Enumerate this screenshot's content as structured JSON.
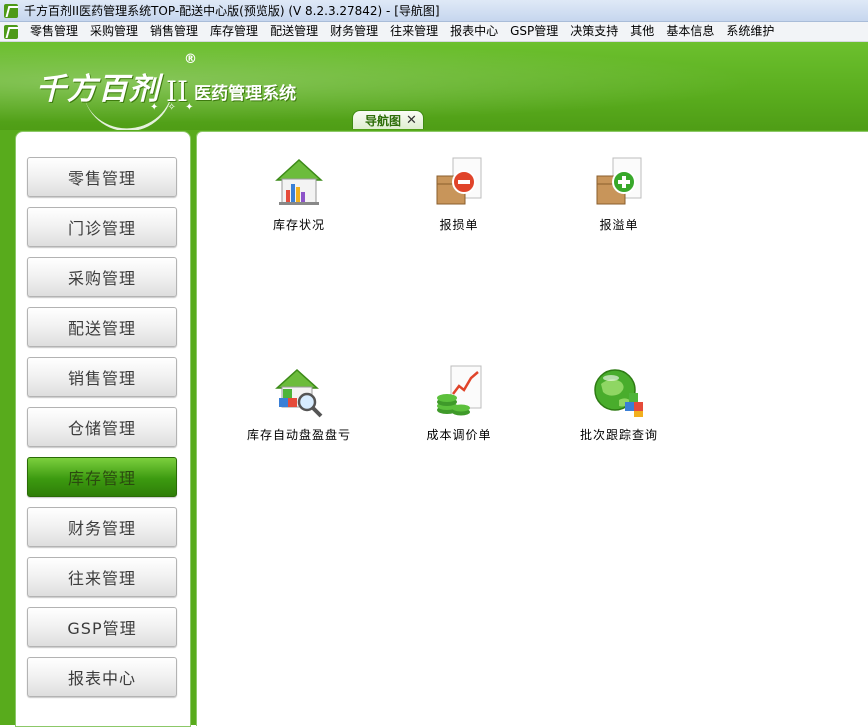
{
  "window": {
    "title": "千方百剂II医药管理系统TOP-配送中心版(预览版) (V 8.2.3.27842)   - [导航图]"
  },
  "menu": [
    "零售管理",
    "采购管理",
    "销售管理",
    "库存管理",
    "配送管理",
    "财务管理",
    "往来管理",
    "报表中心",
    "GSP管理",
    "决策支持",
    "其他",
    "基本信息",
    "系统维护"
  ],
  "brand": {
    "name": "千方百剂",
    "roman": "II",
    "subtitle": "医药管理系统",
    "reg": "®"
  },
  "tab": {
    "label": "导航图",
    "close": "✕"
  },
  "sidebar": {
    "items": [
      {
        "label": "零售管理"
      },
      {
        "label": "门诊管理"
      },
      {
        "label": "采购管理"
      },
      {
        "label": "配送管理"
      },
      {
        "label": "销售管理"
      },
      {
        "label": "仓储管理"
      },
      {
        "label": "库存管理",
        "active": true
      },
      {
        "label": "财务管理"
      },
      {
        "label": "往来管理"
      },
      {
        "label": "GSP管理"
      },
      {
        "label": "报表中心"
      }
    ]
  },
  "tiles": [
    {
      "label": "库存状况",
      "icon": "house-chart-icon"
    },
    {
      "label": "报损单",
      "icon": "box-minus-icon"
    },
    {
      "label": "报溢单",
      "icon": "box-plus-icon"
    },
    {
      "label": "库存自动盘盈盘亏",
      "icon": "house-magnifier-icon"
    },
    {
      "label": "成本调价单",
      "icon": "coins-chart-icon"
    },
    {
      "label": "批次跟踪查询",
      "icon": "globe-blocks-icon"
    }
  ],
  "colors": {
    "brand_green": "#5aad1e",
    "active_green": "#3c9a10",
    "minus_red": "#e0442a",
    "plus_green": "#38a82a"
  }
}
